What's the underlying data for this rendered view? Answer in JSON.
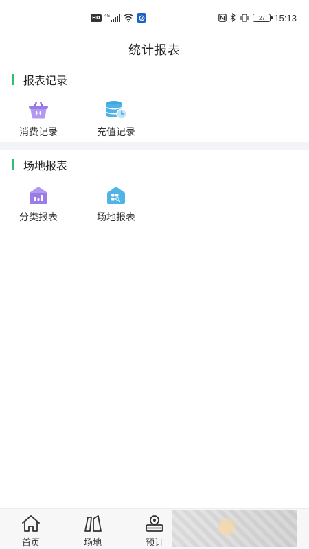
{
  "status_bar": {
    "hd": "HD",
    "network": "4G",
    "battery": "27",
    "time": "15:13"
  },
  "header": {
    "title": "统计报表"
  },
  "sections": [
    {
      "title": "报表记录",
      "items": [
        {
          "label": "消费记录",
          "icon": "basket-icon"
        },
        {
          "label": "充值记录",
          "icon": "coin-stack-clock-icon"
        }
      ]
    },
    {
      "title": "场地报表",
      "items": [
        {
          "label": "分类报表",
          "icon": "category-chart-icon"
        },
        {
          "label": "场地报表",
          "icon": "venue-house-icon"
        }
      ]
    }
  ],
  "colors": {
    "accent": "#2cbf76",
    "purple": "#9b7be8",
    "blue": "#4fb3e8",
    "divider": "#f3f4f8"
  },
  "tab_bar": {
    "tabs": [
      {
        "label": "首页",
        "icon": "home-icon"
      },
      {
        "label": "场地",
        "icon": "venue-icon"
      },
      {
        "label": "预订",
        "icon": "booking-icon"
      }
    ]
  }
}
